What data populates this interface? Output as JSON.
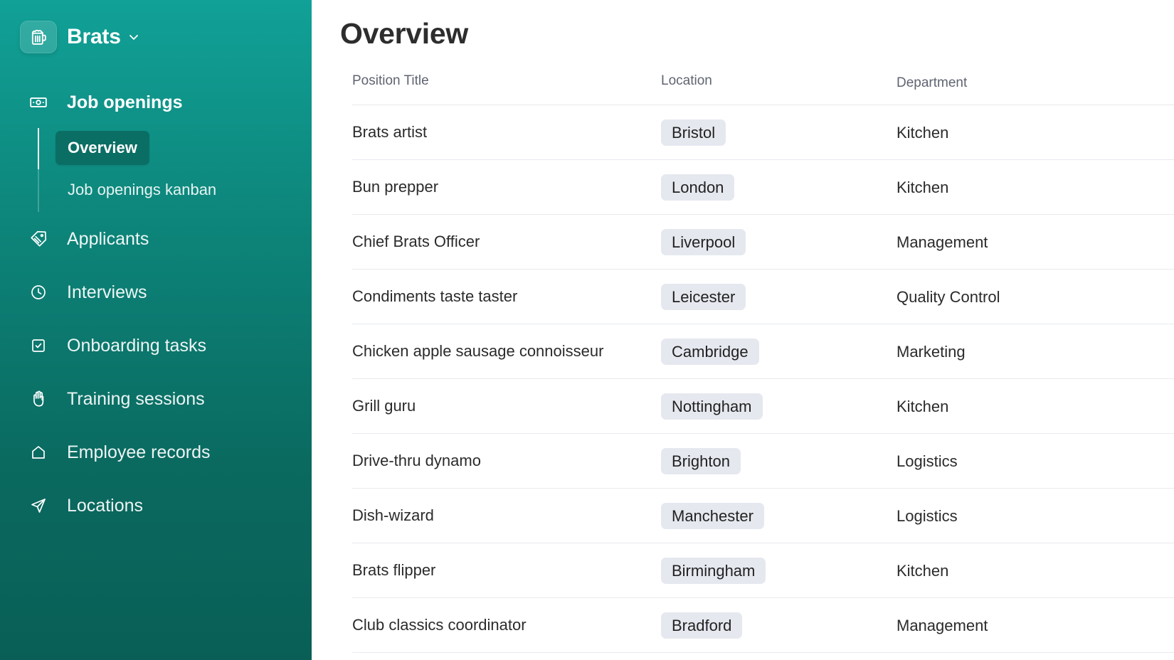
{
  "app": {
    "name": "Brats",
    "logo_icon": "beer-mug-icon",
    "switcher_icon": "chevron-down-icon"
  },
  "sidebar": {
    "sections": [
      {
        "label": "Job openings",
        "icon": "banknote-icon"
      },
      {
        "label": "Applicants",
        "icon": "tag-icon"
      },
      {
        "label": "Interviews",
        "icon": "clock-icon"
      },
      {
        "label": "Onboarding tasks",
        "icon": "checkbox-icon"
      },
      {
        "label": "Training sessions",
        "icon": "hand-icon"
      },
      {
        "label": "Employee records",
        "icon": "home-icon"
      },
      {
        "label": "Locations",
        "icon": "send-icon"
      }
    ],
    "job_openings_sub": [
      {
        "label": "Overview",
        "active": true
      },
      {
        "label": "Job openings kanban",
        "active": false
      }
    ],
    "colors": {
      "gradient_top": "#11a197",
      "gradient_bottom": "#095f56",
      "active_item": "#0b6e64"
    }
  },
  "main": {
    "title": "Overview",
    "columns": [
      "Position Title",
      "Location",
      "Department"
    ],
    "rows": [
      {
        "title": "Brats artist",
        "location": "Bristol",
        "department": "Kitchen"
      },
      {
        "title": "Bun prepper",
        "location": "London",
        "department": "Kitchen"
      },
      {
        "title": "Chief Brats Officer",
        "location": "Liverpool",
        "department": "Management"
      },
      {
        "title": "Condiments taste taster",
        "location": "Leicester",
        "department": "Quality Control"
      },
      {
        "title": "Chicken apple sausage connoisseur",
        "location": "Cambridge",
        "department": "Marketing"
      },
      {
        "title": "Grill guru",
        "location": "Nottingham",
        "department": "Kitchen"
      },
      {
        "title": "Drive-thru dynamo",
        "location": "Brighton",
        "department": "Logistics"
      },
      {
        "title": "Dish-wizard",
        "location": "Manchester",
        "department": "Logistics"
      },
      {
        "title": "Brats flipper",
        "location": "Birmingham",
        "department": "Kitchen"
      },
      {
        "title": "Club classics coordinator",
        "location": "Bradford",
        "department": "Management"
      }
    ]
  }
}
